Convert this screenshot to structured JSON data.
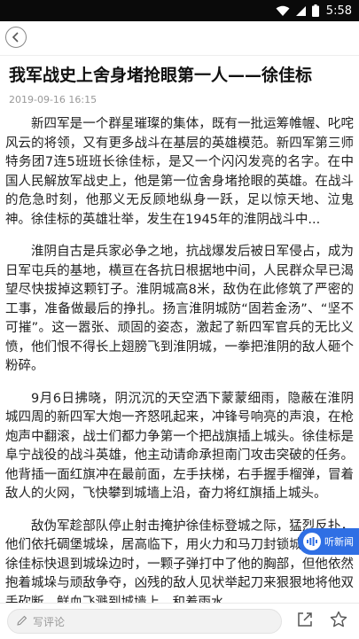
{
  "status_bar": {
    "time": "5:58"
  },
  "article": {
    "title": "我军战史上舍身堵抢眼第一人——徐佳标",
    "date": "2019-09-16 16:15",
    "paragraphs": [
      "新四军是一个群星璀璨的集体，既有一批运筹帷幄、叱咤风云的将领，又有更多战斗在基层的英雄模范。新四军第三师特务团7连5班班长徐佳标，是又一个闪闪发亮的名字。在中国人民解放军战史上，他是第一位舍身堵抢眼的英雄。在战斗的危急时刻，他那义无反顾地纵身一跃，足以惊天地、泣鬼神。徐佳标的英雄壮举，发生在1945年的淮阴战斗中...",
      "淮阴自古是兵家必争之地，抗战爆发后被日军侵占，成为日军屯兵的基地，横亘在各抗日根据地中间，人民群众早已渴望尽快拔掉这颗钉子。淮阴城高8米，敌伪在此修筑了严密的工事，准备做最后的挣扎。扬言淮阴城防“固若金汤”、“坚不可摧”。这一嚣张、顽固的姿态，激起了新四军官兵的无比义愤，他们恨不得长上翅膀飞到淮阴城，一拳把淮阴的敌人砸个粉碎。",
      "9月6日拂晓，阴沉沉的天空洒下蒙蒙细雨，隐蔽在淮阴城四周的新四军大炮一齐怒吼起来，冲锋号响亮的声浪，在枪炮声中翻滚，战士们都力争第一个把战旗插上城头。徐佳标是阜宁战役的战斗英雄，他主动请命承担南门攻击突破的任务。他背插一面红旗冲在最前面，左手扶梯，右手握手榴弹，冒着敌人的火网，飞快攀到城墙上沿，奋力将红旗插上城头。",
      "敌伪军趁部队停止射击掩护徐佳标登城之际，猛烈反扑，他们依托碉堡城垛，居高临下，用火力和马刀封锁城垛点。当徐佳标快退到城垛边时，一颗子弹打中了他的胸部，但他依然抱着城垛与顽敌争夺，凶残的敌人见状举起刀来狠狠地将他双手砍断，鲜血飞溅到城墙上，和着雨水"
    ]
  },
  "listen_button": {
    "label": "听新闻"
  },
  "bottom_bar": {
    "comment_placeholder": "写评论"
  }
}
